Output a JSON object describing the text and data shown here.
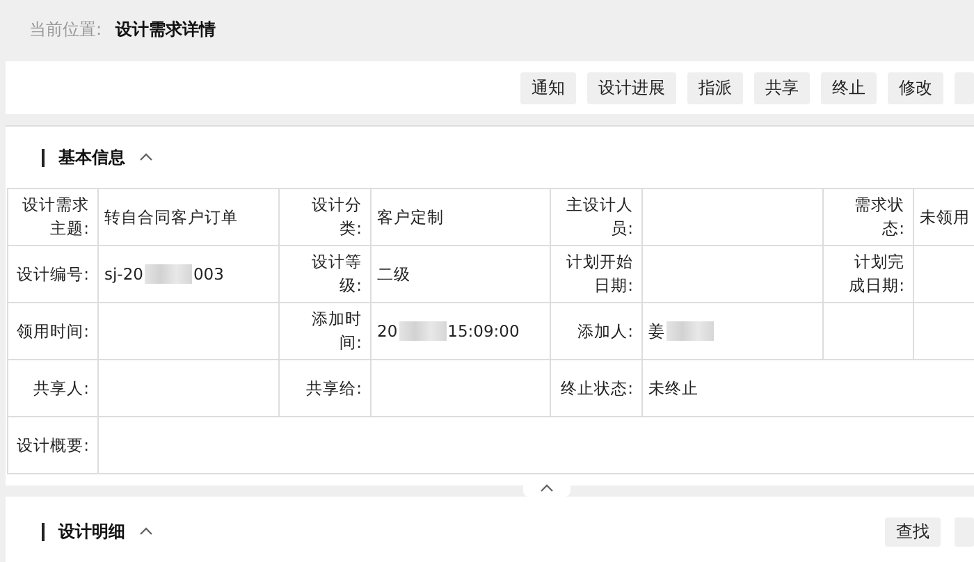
{
  "breadcrumb": {
    "label": "当前位置:",
    "current": "设计需求详情"
  },
  "toolbar": {
    "buttons": [
      "通知",
      "设计进展",
      "指派",
      "共享",
      "终止",
      "修改"
    ],
    "cut_button": true
  },
  "basic_info": {
    "title": "基本信息",
    "expanded": true,
    "rows": [
      {
        "fields": [
          {
            "label": "设计需求主题:",
            "value": "转自合同客户订单"
          },
          {
            "label": "设计分类:",
            "value": "客户定制"
          },
          {
            "label": "主设计人员:"
          },
          {
            "label": "需求状态:",
            "value": "未领用"
          }
        ]
      },
      {
        "fields": [
          {
            "label": "设计编号:",
            "value_parts": [
              {
                "kind": "text",
                "text": "sj-20"
              },
              {
                "kind": "blur"
              },
              {
                "kind": "text",
                "text": "003"
              }
            ]
          },
          {
            "label": "设计等级:",
            "value": "二级"
          },
          {
            "label": "计划开始日期:"
          },
          {
            "label": "计划完成日期:"
          }
        ]
      },
      {
        "last_value_spans": false,
        "fields": [
          {
            "label": "领用时间:"
          },
          {
            "label": "添加时间:",
            "value_parts": [
              {
                "kind": "text",
                "text": "20"
              },
              {
                "kind": "blur"
              },
              {
                "kind": "text",
                "text": "15:09:00"
              }
            ]
          },
          {
            "label": "添加人:",
            "value_parts": [
              {
                "kind": "text",
                "text": "姜"
              },
              {
                "kind": "blur"
              }
            ]
          }
        ]
      },
      {
        "last_value_spans": true,
        "fields": [
          {
            "label": "共享人:"
          },
          {
            "label": "共享给:"
          },
          {
            "label": "终止状态:",
            "value": "未终止"
          }
        ]
      },
      {
        "last_value_spans": true,
        "fields": [
          {
            "label": "设计概要:"
          }
        ]
      }
    ]
  },
  "detail": {
    "title": "设计明细",
    "expanded": true,
    "buttons": [
      "查找"
    ],
    "cut_button": true
  }
}
